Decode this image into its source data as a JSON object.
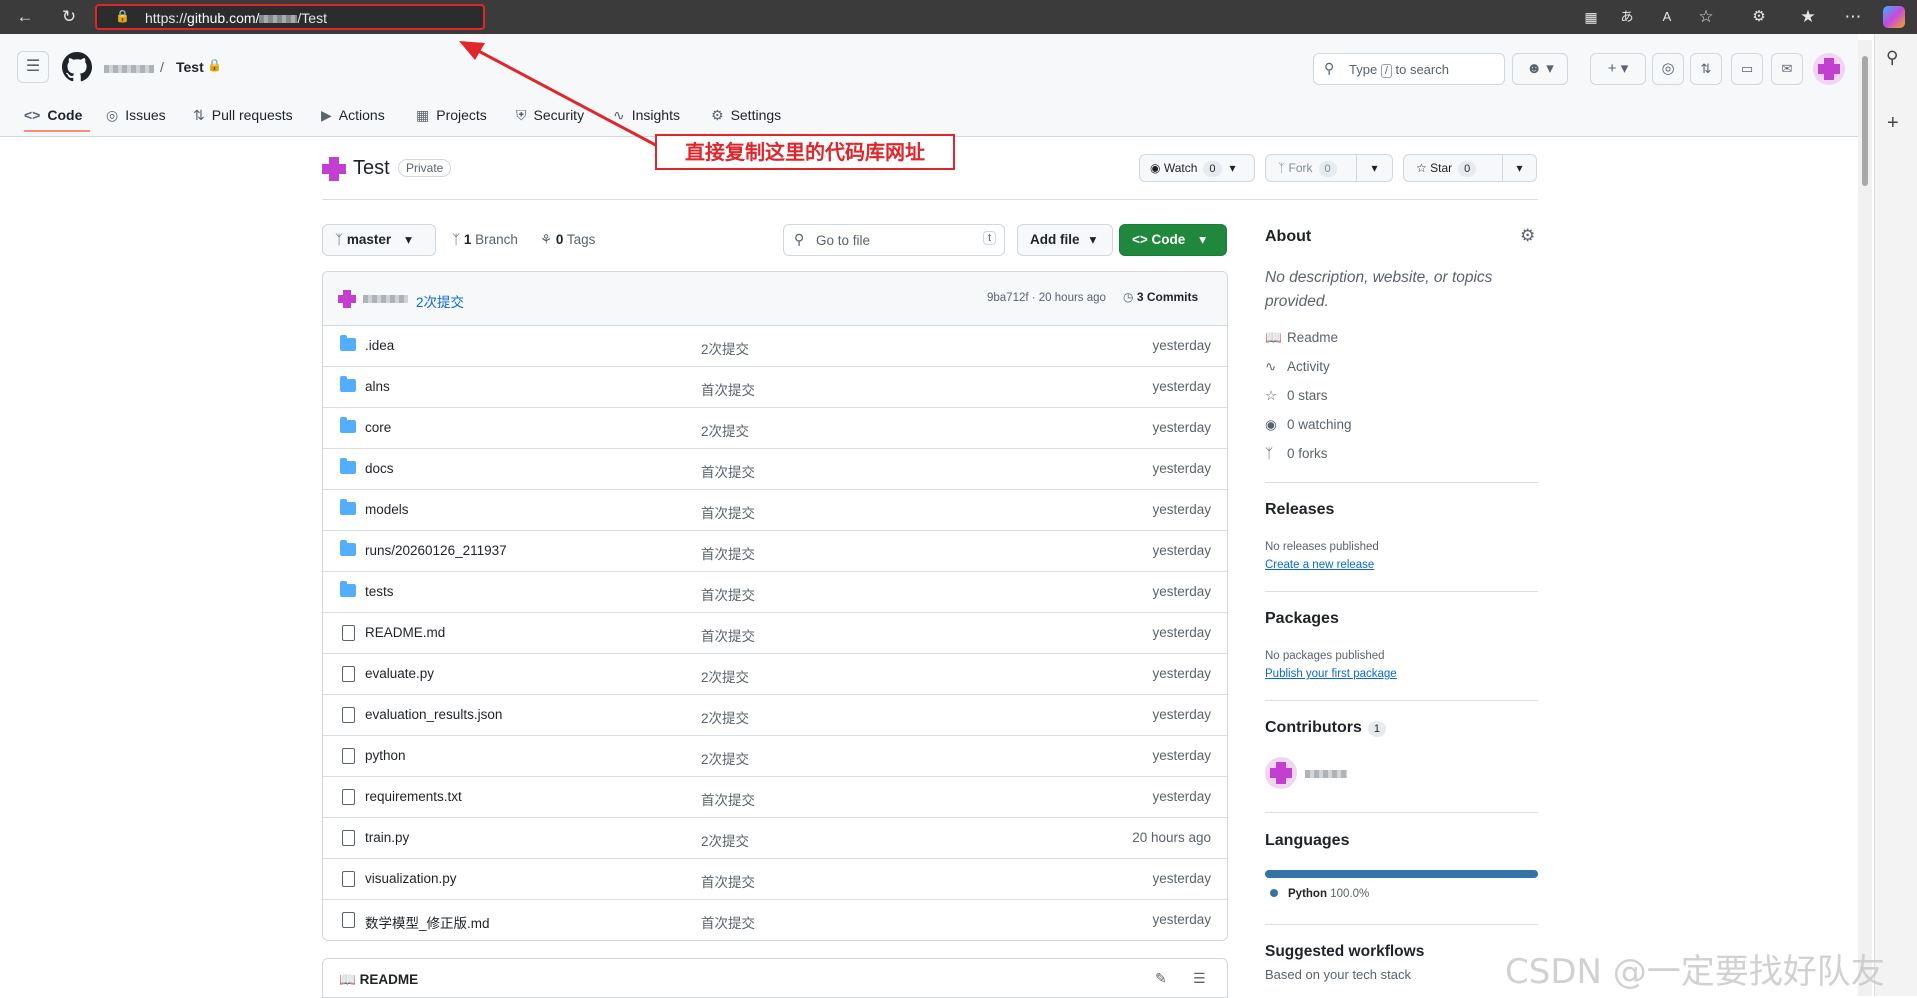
{
  "browser": {
    "url_prefix": "https://",
    "url_host": "github.com/",
    "url_suffix": "/Test"
  },
  "header": {
    "repo_name": "Test",
    "search_placeholder": "Type / to search",
    "search_placeholder_pre": "Type",
    "search_placeholder_key": "/",
    "search_placeholder_post": "to search"
  },
  "tabs": [
    {
      "label": "Code"
    },
    {
      "label": "Issues"
    },
    {
      "label": "Pull requests"
    },
    {
      "label": "Actions"
    },
    {
      "label": "Projects"
    },
    {
      "label": "Security"
    },
    {
      "label": "Insights"
    },
    {
      "label": "Settings"
    }
  ],
  "annotation": "直接复制这里的代码库网址",
  "repo": {
    "title": "Test",
    "visibility": "Private",
    "watch_label": "Watch",
    "watch_count": "0",
    "fork_label": "Fork",
    "fork_count": "0",
    "star_label": "Star",
    "star_count": "0"
  },
  "toolbar": {
    "branch": "master",
    "branches_count": "1",
    "branches_label": "Branch",
    "tags_count": "0",
    "tags_label": "Tags",
    "go_to_file": "Go to file",
    "go_to_file_key": "t",
    "add_file": "Add file",
    "code": "Code"
  },
  "commit": {
    "message": "2次提交",
    "hash_time": "9ba712f · 20 hours ago",
    "commits_label": "3 Commits"
  },
  "files": [
    {
      "name": ".idea",
      "type": "dir",
      "message": "2次提交",
      "time": "yesterday"
    },
    {
      "name": "alns",
      "type": "dir",
      "message": "首次提交",
      "time": "yesterday"
    },
    {
      "name": "core",
      "type": "dir",
      "message": "2次提交",
      "time": "yesterday"
    },
    {
      "name": "docs",
      "type": "dir",
      "message": "首次提交",
      "time": "yesterday"
    },
    {
      "name": "models",
      "type": "dir",
      "message": "首次提交",
      "time": "yesterday"
    },
    {
      "name": "runs/20260126_211937",
      "type": "dir",
      "message": "首次提交",
      "time": "yesterday"
    },
    {
      "name": "tests",
      "type": "dir",
      "message": "首次提交",
      "time": "yesterday"
    },
    {
      "name": "README.md",
      "type": "file",
      "message": "首次提交",
      "time": "yesterday"
    },
    {
      "name": "evaluate.py",
      "type": "file",
      "message": "2次提交",
      "time": "yesterday"
    },
    {
      "name": "evaluation_results.json",
      "type": "file",
      "message": "2次提交",
      "time": "yesterday"
    },
    {
      "name": "python",
      "type": "file",
      "message": "2次提交",
      "time": "yesterday"
    },
    {
      "name": "requirements.txt",
      "type": "file",
      "message": "首次提交",
      "time": "yesterday"
    },
    {
      "name": "train.py",
      "type": "file",
      "message": "2次提交",
      "time": "20 hours ago"
    },
    {
      "name": "visualization.py",
      "type": "file",
      "message": "首次提交",
      "time": "yesterday"
    },
    {
      "name": "数学模型_修正版.md",
      "type": "file",
      "message": "首次提交",
      "time": "yesterday"
    }
  ],
  "readme_label": "README",
  "about": {
    "heading": "About",
    "description": "No description, website, or topics provided.",
    "readme": "Readme",
    "activity": "Activity",
    "stars": "0 stars",
    "watching": "0 watching",
    "forks": "0 forks"
  },
  "releases": {
    "heading": "Releases",
    "none_text": "No releases published",
    "create_link": "Create a new release"
  },
  "packages": {
    "heading": "Packages",
    "none_text": "No packages published",
    "publish_link": "Publish your first package"
  },
  "contributors": {
    "heading": "Contributors",
    "count": "1"
  },
  "languages": {
    "heading": "Languages",
    "items": [
      {
        "name": "Python",
        "percent": "100.0%",
        "color": "#3572A5",
        "share": 1.0
      }
    ]
  },
  "workflows": {
    "heading": "Suggested workflows",
    "subtext": "Based on your tech stack"
  },
  "watermark": "CSDN @一定要找好队友",
  "colors": {
    "accent_green": "#1f883d",
    "link_blue": "#0969da",
    "annotation_red": "#e0262b",
    "tab_underline": "#fd8c73"
  }
}
